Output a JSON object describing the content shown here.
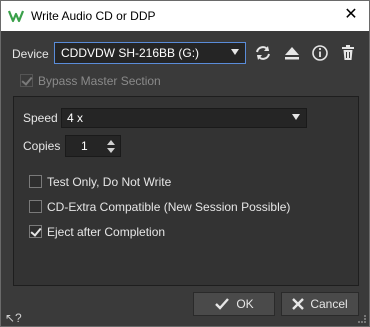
{
  "window": {
    "title": "Write Audio CD or DDP",
    "close_glyph": "✕"
  },
  "device": {
    "label": "Device",
    "value": "CDDVDW SH-216BB (G:)"
  },
  "toolbar": {
    "icons": [
      "refresh-icon",
      "eject-icon",
      "info-icon",
      "trash-icon"
    ]
  },
  "bypass": {
    "label": "Bypass Master Section",
    "checked": true,
    "disabled": true
  },
  "speed": {
    "label": "Speed",
    "value": "4 x"
  },
  "copies": {
    "label": "Copies",
    "value": "1"
  },
  "options": [
    {
      "label": "Test Only, Do Not Write",
      "checked": false
    },
    {
      "label": "CD-Extra Compatible (New Session Possible)",
      "checked": false
    },
    {
      "label": "Eject after Completion",
      "checked": true
    }
  ],
  "buttons": {
    "ok_label": "OK",
    "cancel_label": "Cancel"
  },
  "help_glyph": "↖?",
  "colors": {
    "accent": "#5a8cd9",
    "background": "#3a3a3a",
    "titlebar": "#ffffff"
  }
}
